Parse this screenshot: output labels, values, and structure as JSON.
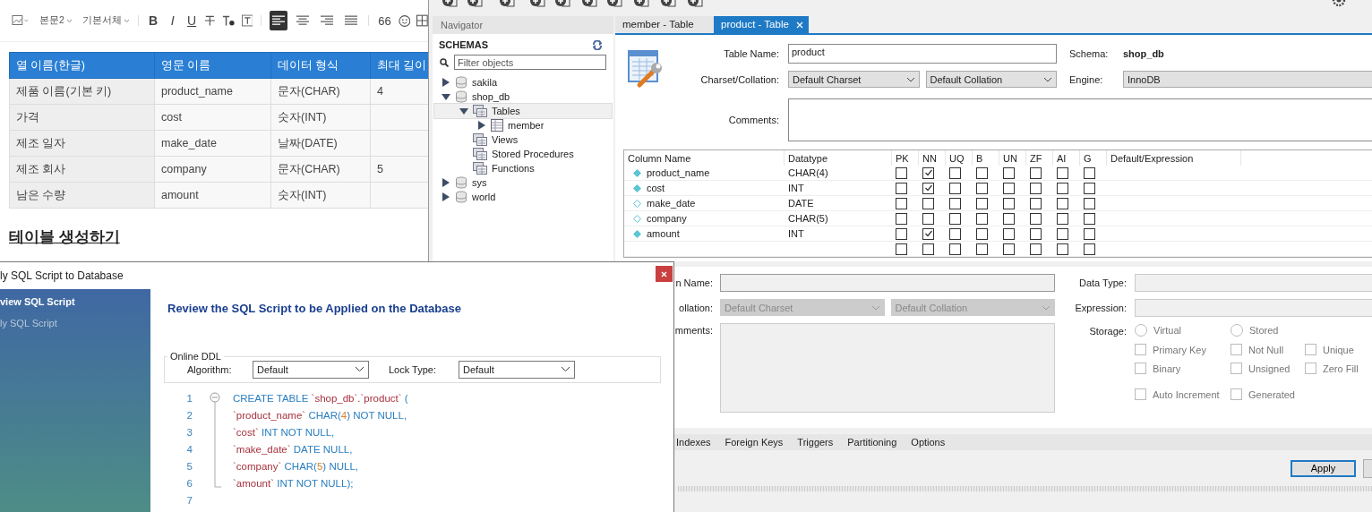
{
  "editor": {
    "toolbar": {
      "paragraph_style": "본문2",
      "font": "기본서체",
      "format_buttons": [
        {
          "kind": "bold",
          "label": "B"
        },
        {
          "kind": "italic",
          "label": "I"
        },
        {
          "kind": "underline",
          "label": "U"
        }
      ],
      "alignment": [
        {
          "kind": "left",
          "selected": true
        },
        {
          "kind": "center",
          "selected": false
        },
        {
          "kind": "right",
          "selected": false
        },
        {
          "kind": "justify",
          "selected": false
        }
      ],
      "quote_label": "66"
    },
    "table": {
      "columns": [
        "열 이름(한글)",
        "영문 이름",
        "데이터 형식",
        "최대 길이"
      ],
      "rows": [
        [
          "제품 이름(기본 키)",
          "product_name",
          "문자(CHAR)",
          "4"
        ],
        [
          "가격",
          "cost",
          "숫자(INT)",
          ""
        ],
        [
          "제조 일자",
          "make_date",
          "날짜(DATE)",
          ""
        ],
        [
          "제조 회사",
          "company",
          "문자(CHAR)",
          "5"
        ],
        [
          "남은 수량",
          "amount",
          "숫자(INT)",
          ""
        ]
      ]
    },
    "heading": "테이블 생성하기"
  },
  "workbench": {
    "navigator": {
      "title": "Navigator",
      "section": "SCHEMAS",
      "filter_placeholder": "Filter objects",
      "tree": [
        {
          "kind": "schema",
          "label": "sakila",
          "expanded": false,
          "selected": false
        },
        {
          "kind": "schema",
          "label": "shop_db",
          "expanded": true,
          "selected": false,
          "children": [
            {
              "kind": "folder",
              "label": "Tables",
              "expanded": true,
              "selected": true,
              "children": [
                {
                  "kind": "table",
                  "label": "member",
                  "expanded": false,
                  "selected": false
                }
              ]
            },
            {
              "kind": "folder",
              "label": "Views",
              "selected": false
            },
            {
              "kind": "folder",
              "label": "Stored Procedures",
              "selected": false
            },
            {
              "kind": "folder",
              "label": "Functions",
              "selected": false
            }
          ]
        },
        {
          "kind": "schema",
          "label": "sys",
          "expanded": false,
          "selected": false
        },
        {
          "kind": "schema",
          "label": "world",
          "expanded": false,
          "selected": false
        }
      ]
    },
    "tabs": [
      {
        "label": "member - Table",
        "selected": false
      },
      {
        "label": "product - Table",
        "selected": true
      }
    ],
    "form": {
      "table_name_label": "Table Name:",
      "table_name": "product",
      "schema_label": "Schema:",
      "schema": "shop_db",
      "charset_label": "Charset/Collation:",
      "charset": "Default Charset",
      "collation": "Default Collation",
      "engine_label": "Engine:",
      "engine": "InnoDB",
      "comments_label": "Comments:"
    },
    "grid": {
      "headers": [
        "Column Name",
        "Datatype",
        "PK",
        "NN",
        "UQ",
        "B",
        "UN",
        "ZF",
        "AI",
        "G",
        "Default/Expression"
      ],
      "rows": [
        {
          "kind": "column",
          "name": "product_name",
          "datatype": "CHAR(4)",
          "flags": [
            false,
            true,
            false,
            false,
            false,
            false,
            false,
            false
          ]
        },
        {
          "kind": "column",
          "name": "cost",
          "datatype": "INT",
          "flags": [
            false,
            true,
            false,
            false,
            false,
            false,
            false,
            false
          ]
        },
        {
          "kind": "column",
          "name": "make_date",
          "datatype": "DATE",
          "flags": [
            false,
            false,
            false,
            false,
            false,
            false,
            false,
            false
          ]
        },
        {
          "kind": "column",
          "name": "company",
          "datatype": "CHAR(5)",
          "flags": [
            false,
            false,
            false,
            false,
            false,
            false,
            false,
            false
          ]
        },
        {
          "kind": "column",
          "name": "amount",
          "datatype": "INT",
          "flags": [
            false,
            true,
            false,
            false,
            false,
            false,
            false,
            false
          ]
        },
        {
          "kind": "new",
          "flags": [
            false,
            false,
            false,
            false,
            false,
            false,
            false,
            false
          ]
        }
      ]
    },
    "details": {
      "name_label": "n Name:",
      "collation_label": "ollation:",
      "comments_label": "mments:",
      "charset": "Default Charset",
      "collation": "Default Collation",
      "data_type_label": "Data Type:",
      "expression_label": "Expression:",
      "storage_label": "Storage:",
      "options": [
        [
          {
            "kind": "radio",
            "label": "Virtual",
            "checked": false
          },
          {
            "kind": "radio",
            "label": "Stored",
            "checked": false
          }
        ],
        [
          {
            "kind": "check",
            "label": "Primary Key",
            "checked": false
          },
          {
            "kind": "check",
            "label": "Not Null",
            "checked": false
          },
          {
            "kind": "check",
            "label": "Unique",
            "checked": false
          }
        ],
        [
          {
            "kind": "check",
            "label": "Binary",
            "checked": false
          },
          {
            "kind": "check",
            "label": "Unsigned",
            "checked": false
          },
          {
            "kind": "check",
            "label": "Zero Fill",
            "checked": false
          }
        ],
        [
          {
            "kind": "check",
            "label": "Auto Increment",
            "checked": false
          },
          {
            "kind": "check",
            "label": "Generated",
            "checked": false
          }
        ]
      ]
    },
    "subtabs": [
      "Indexes",
      "Foreign Keys",
      "Triggers",
      "Partitioning",
      "Options"
    ],
    "apply": "Apply"
  },
  "dialog": {
    "title": "ly SQL Script to Database",
    "steps": [
      {
        "label": "view SQL Script",
        "selected": true
      },
      {
        "label": "ly SQL Script",
        "selected": false
      }
    ],
    "heading": "Review the SQL Script to be Applied on the Database",
    "group_title": "Online DDL",
    "algorithm_label": "Algorithm:",
    "algorithm": "Default",
    "lock_label": "Lock Type:",
    "lock": "Default",
    "code": [
      {
        "number": "1",
        "tokens": [
          {
            "kind": "keyword",
            "text": "CREATE TABLE "
          },
          {
            "kind": "ident",
            "text": "`shop_db`.`product`"
          },
          {
            "kind": "keyword",
            "text": " ("
          }
        ]
      },
      {
        "number": "2",
        "tokens": [
          {
            "kind": "ident",
            "text": "`product_name`"
          },
          {
            "kind": "keyword",
            "text": " CHAR("
          },
          {
            "kind": "number",
            "text": "4"
          },
          {
            "kind": "keyword",
            "text": ") NOT NULL,"
          }
        ]
      },
      {
        "number": "3",
        "tokens": [
          {
            "kind": "ident",
            "text": "`cost`"
          },
          {
            "kind": "keyword",
            "text": " INT NOT NULL,"
          }
        ]
      },
      {
        "number": "4",
        "tokens": [
          {
            "kind": "ident",
            "text": "`make_date`"
          },
          {
            "kind": "keyword",
            "text": " DATE NULL,"
          }
        ]
      },
      {
        "number": "5",
        "tokens": [
          {
            "kind": "ident",
            "text": "`company`"
          },
          {
            "kind": "keyword",
            "text": " CHAR("
          },
          {
            "kind": "number",
            "text": "5"
          },
          {
            "kind": "keyword",
            "text": ") NULL,"
          }
        ]
      },
      {
        "number": "6",
        "tokens": [
          {
            "kind": "ident",
            "text": "`amount`"
          },
          {
            "kind": "keyword",
            "text": " INT NOT NULL);"
          }
        ]
      },
      {
        "number": "7"
      }
    ]
  }
}
